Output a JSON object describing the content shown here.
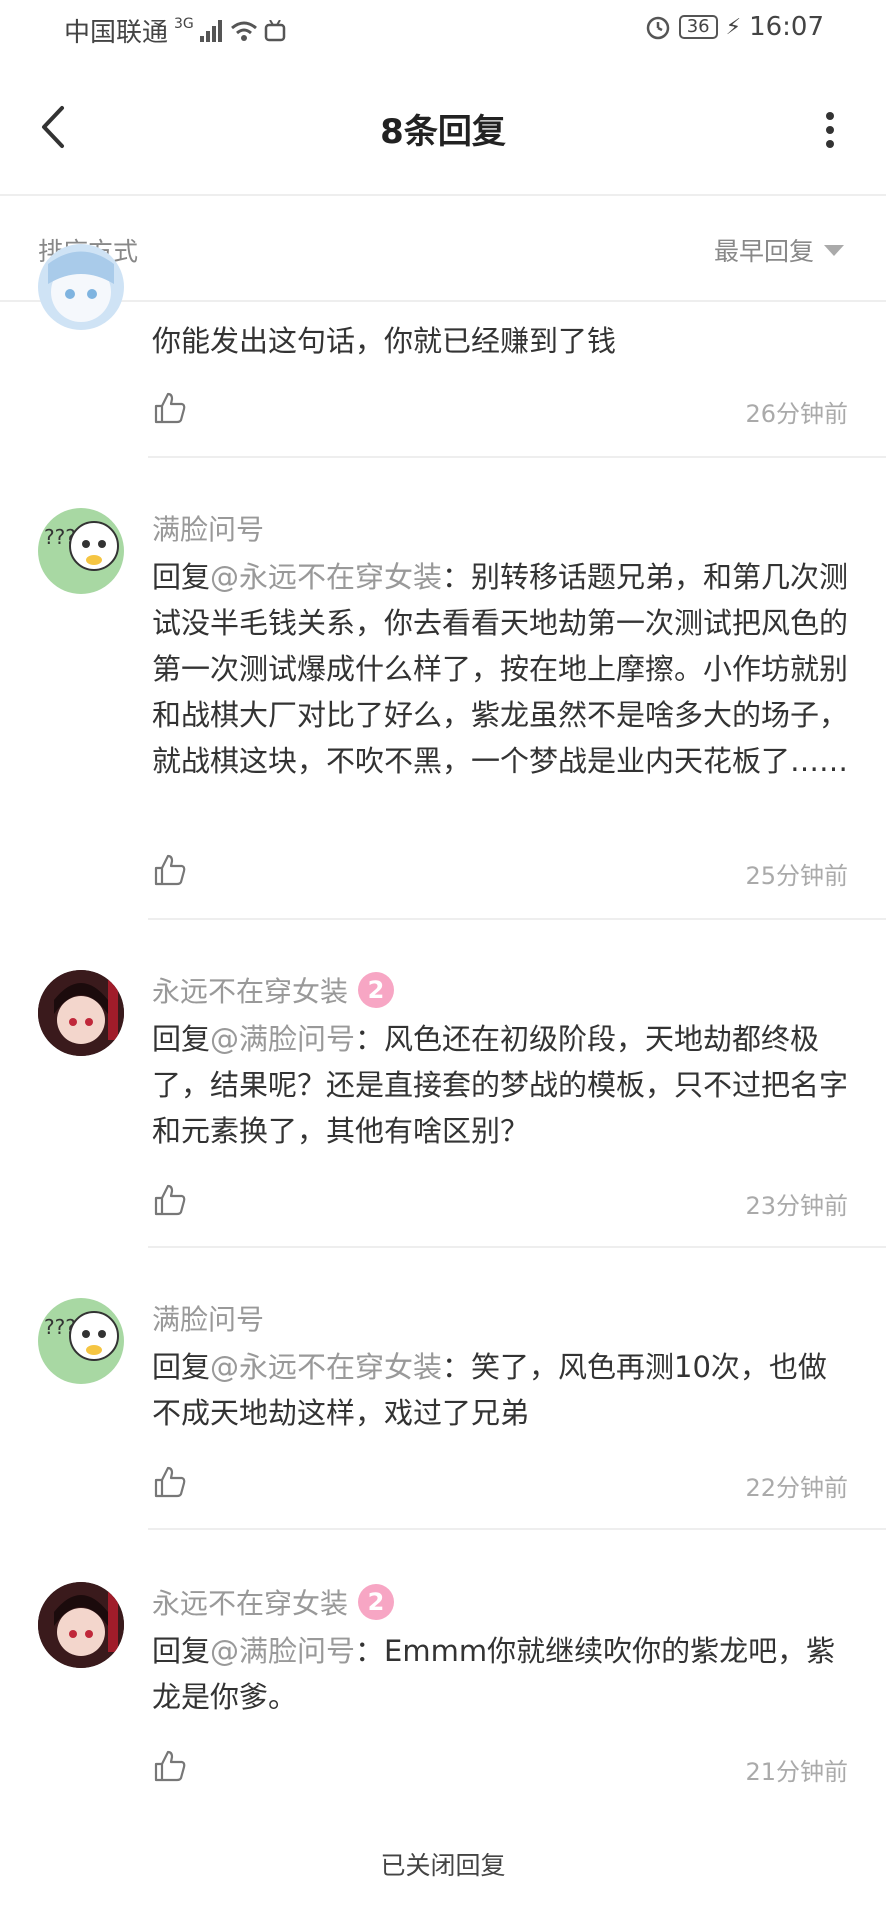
{
  "status_bar": {
    "carrier": "中国联通",
    "network": "3G",
    "battery": "36",
    "time": "16:07"
  },
  "header": {
    "title": "8条回复"
  },
  "sort": {
    "label": "排序方式",
    "selected": "最早回复"
  },
  "comments": [
    {
      "username": "",
      "level": "",
      "reply_prefix": "",
      "reply_to": "",
      "text": "你能发出这句话，你就已经赚到了钱",
      "time": "26分钟前"
    },
    {
      "username": "满脸问号",
      "level": "",
      "reply_prefix": "回复",
      "reply_to": "@永远不在穿女装",
      "text": "：别转移话题兄弟，和第几次测试没半毛钱关系，你去看看天地劫第一次测试把风色的第一次测试爆成什么样了，按在地上摩擦。小作坊就别和战棋大厂对比了好么，紫龙虽然不是啥多大的场子，就战棋这块，不吹不黑，一个梦战是业内天花板了……",
      "time": "25分钟前"
    },
    {
      "username": "永远不在穿女装",
      "level": "2",
      "reply_prefix": "回复",
      "reply_to": "@满脸问号",
      "text": "：风色还在初级阶段，天地劫都终极了，结果呢？还是直接套的梦战的模板，只不过把名字和元素换了，其他有啥区别？",
      "time": "23分钟前"
    },
    {
      "username": "满脸问号",
      "level": "",
      "reply_prefix": "回复",
      "reply_to": "@永远不在穿女装",
      "text": "：笑了，风色再测10次，也做不成天地劫这样，戏过了兄弟",
      "time": "22分钟前"
    },
    {
      "username": "永远不在穿女装",
      "level": "2",
      "reply_prefix": "回复",
      "reply_to": "@满脸问号",
      "text": "：Emmm你就继续吹你的紫龙吧，紫龙是你爹。",
      "time": "21分钟前"
    }
  ],
  "footer": {
    "closed_text": "已关闭回复"
  },
  "colors": {
    "level_badge": "#f7a6c4",
    "muted_text": "#999999",
    "divider": "#eeeeee"
  }
}
